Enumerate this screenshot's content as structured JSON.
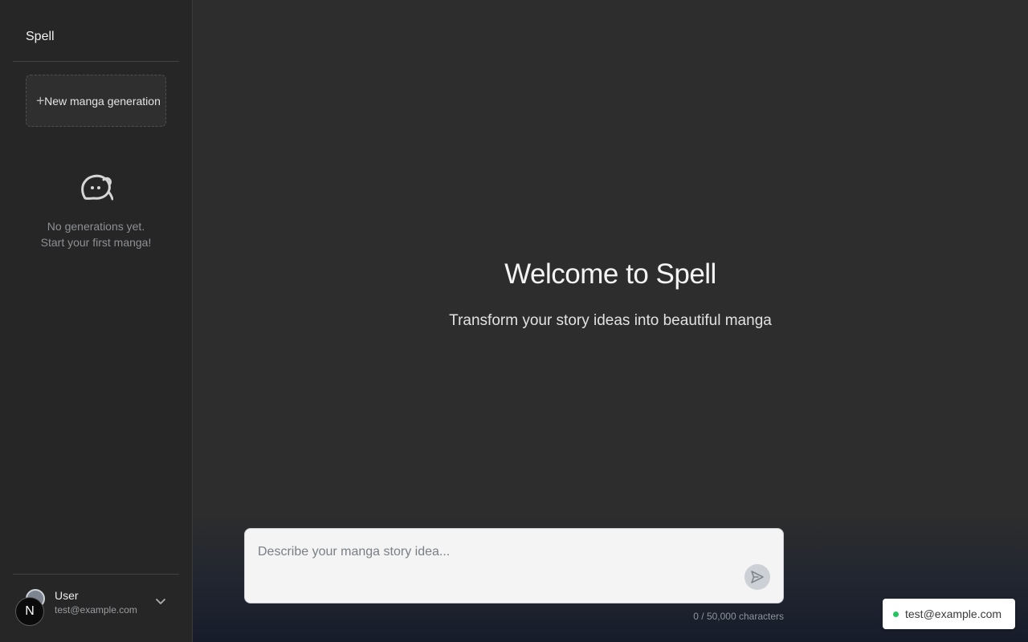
{
  "sidebar": {
    "brand": "Spell",
    "new_button_label": "New manga generation",
    "new_button_icon": "plus-icon",
    "empty_icon": "ghost-icon",
    "empty_line1": "No generations yet.",
    "empty_line2": "Start your first manga!",
    "user": {
      "avatar_letter": "N",
      "name": "User",
      "email": "test@example.com",
      "menu_icon": "chevron-down-icon"
    }
  },
  "main": {
    "title": "Welcome to Spell",
    "subtitle": "Transform your story ideas into beautiful manga",
    "composer": {
      "placeholder": "Describe your manga story idea...",
      "value": "",
      "send_icon": "send-icon",
      "char_count": "0 / 50,000 characters"
    }
  },
  "toast": {
    "status_color": "#22c55e",
    "text": "test@example.com"
  },
  "colors": {
    "background": "#2d2d2d",
    "sidebar": "#262626",
    "composer": "#f3f4f3"
  }
}
